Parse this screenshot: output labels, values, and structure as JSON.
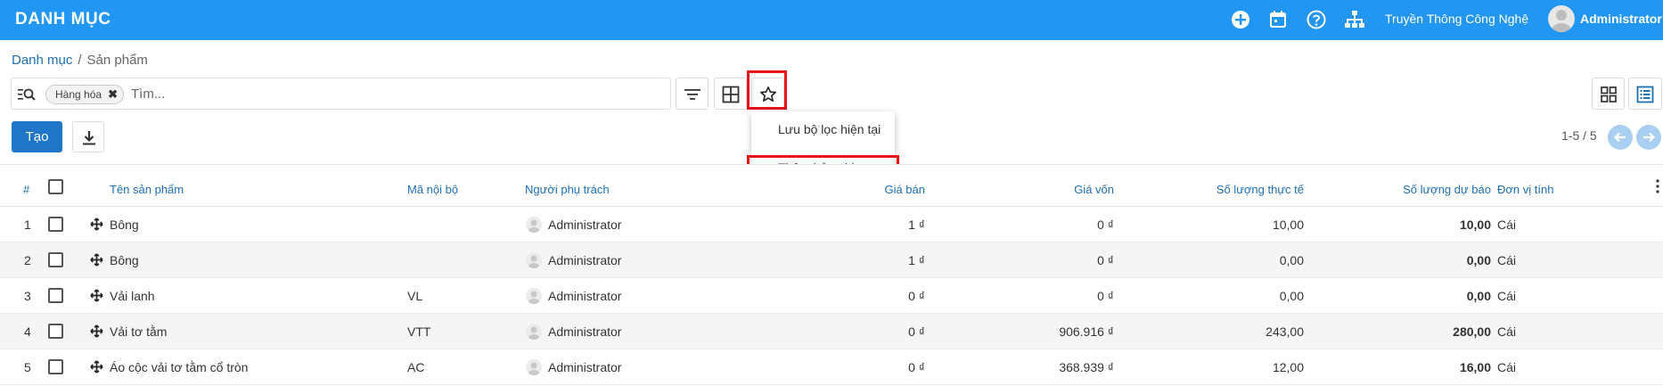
{
  "header": {
    "app_title": "DANH MỤC",
    "company": "Truyền Thông Công Nghệ",
    "user": "Administrator",
    "icons": [
      "plus-circle-icon",
      "calendar-icon",
      "help-icon",
      "sitemap-icon"
    ]
  },
  "breadcrumb": {
    "parent": "Danh mục",
    "separator": "/",
    "current": "Sản phẩm"
  },
  "search": {
    "facet": "Hàng hóa",
    "placeholder": "Tìm..."
  },
  "favorites_menu": {
    "items": [
      "Lưu bộ lọc hiện tại",
      "Thêm bản ghi"
    ]
  },
  "actions": {
    "create": "Tạo"
  },
  "pager": {
    "value": "1-5 / 5"
  },
  "table": {
    "columns": [
      "#",
      "Tên sản phẩm",
      "Mã nội bộ",
      "Người phụ trách",
      "Giá bán",
      "Giá vốn",
      "Số lượng thực tế",
      "Số lượng dự báo",
      "Đơn vị tính"
    ],
    "rows": [
      {
        "idx": "1",
        "name": "Bông",
        "code": "",
        "owner": "Administrator",
        "price": "1 ₫",
        "cost": "0 ₫",
        "qty_actual": "10,00",
        "qty_forecast": "10,00",
        "uom": "Cái"
      },
      {
        "idx": "2",
        "name": "Bông",
        "code": "",
        "owner": "Administrator",
        "price": "1 ₫",
        "cost": "0 ₫",
        "qty_actual": "0,00",
        "qty_forecast": "0,00",
        "uom": "Cái"
      },
      {
        "idx": "3",
        "name": "Vải lanh",
        "code": "VL",
        "owner": "Administrator",
        "price": "0 ₫",
        "cost": "0 ₫",
        "qty_actual": "0,00",
        "qty_forecast": "0,00",
        "uom": "Cái"
      },
      {
        "idx": "4",
        "name": "Vải tơ tằm",
        "code": "VTT",
        "owner": "Administrator",
        "price": "0 ₫",
        "cost": "906.916 ₫",
        "qty_actual": "243,00",
        "qty_forecast": "280,00",
        "uom": "Cái"
      },
      {
        "idx": "5",
        "name": "Áo cộc vải tơ tằm cổ tròn",
        "code": "AC",
        "owner": "Administrator",
        "price": "0 ₫",
        "cost": "368.939 ₫",
        "qty_actual": "12,00",
        "qty_forecast": "16,00",
        "uom": "Cái"
      }
    ]
  },
  "colors": {
    "primary": "#2196f3",
    "button": "#1f76c8",
    "highlight": "#e8141b",
    "link": "#1f6fb2"
  }
}
